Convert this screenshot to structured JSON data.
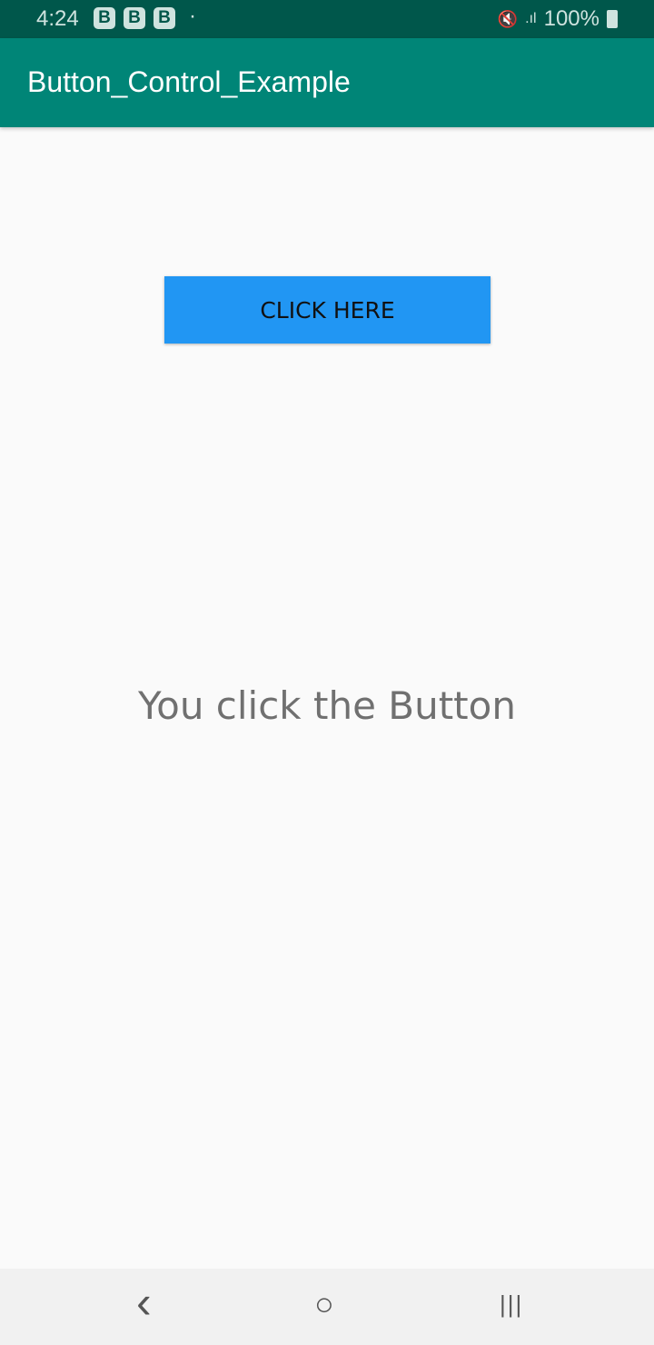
{
  "status": {
    "time": "4:24",
    "badges": [
      "B",
      "B",
      "B"
    ],
    "dot": "·",
    "signal": "📶",
    "battery": "100%"
  },
  "appbar": {
    "title": "Button_Control_Example"
  },
  "main": {
    "button_label": "CLICK HERE",
    "message": "You click the Button"
  },
  "nav": {
    "back": "‹",
    "home": "○",
    "recents": "|||"
  }
}
